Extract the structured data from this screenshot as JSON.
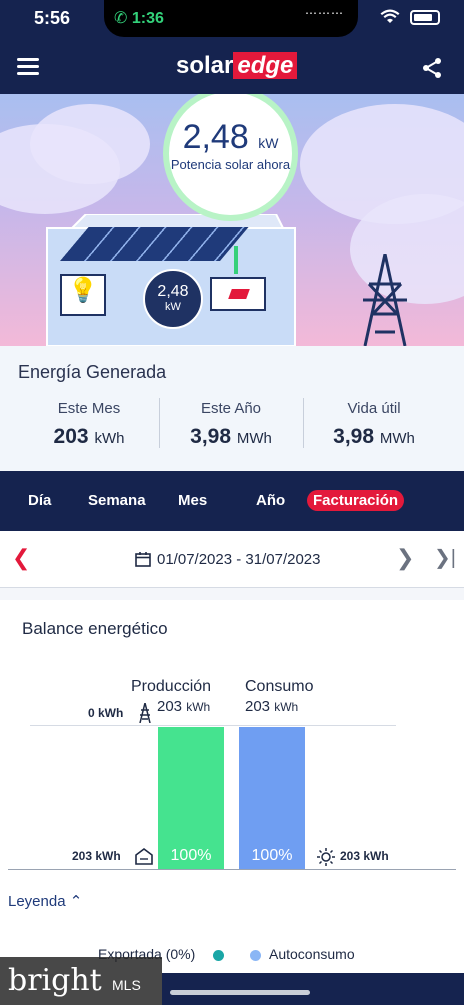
{
  "status_bar": {
    "time": "5:56",
    "call_time": "1:36"
  },
  "header": {
    "brand_solar": "solar",
    "brand_edge": "edge"
  },
  "hero": {
    "power_value": "2,48",
    "power_unit": "kW",
    "power_label": "Potencia solar ahora",
    "inverter_value": "2,48",
    "inverter_unit": "kW"
  },
  "energy": {
    "title": "Energía Generada",
    "stats": [
      {
        "label": "Este Mes",
        "value": "203",
        "unit": "kWh"
      },
      {
        "label": "Este Año",
        "value": "3,98",
        "unit": "MWh"
      },
      {
        "label": "Vida útil",
        "value": "3,98",
        "unit": "MWh"
      }
    ]
  },
  "tabs": [
    {
      "label": "Día"
    },
    {
      "label": "Semana"
    },
    {
      "label": "Mes"
    },
    {
      "label": "Año"
    },
    {
      "label": "Facturación",
      "active": true
    }
  ],
  "date_range": "01/07/2023 - 31/07/2023",
  "balance": {
    "title": "Balance energético",
    "production_label": "Producción",
    "production_value": "203",
    "production_unit": "kWh",
    "consumption_label": "Consumo",
    "consumption_value": "203",
    "consumption_unit": "kWh",
    "grid_export": "0 kWh",
    "self_left": "203 kWh",
    "self_right": "203 kWh",
    "production_pct": "100%",
    "consumption_pct": "100%",
    "colors": {
      "production": "#45e38f",
      "consumption": "#6f9ef2"
    }
  },
  "legend": {
    "title": "Leyenda",
    "items": [
      {
        "label": "Exportada (0%)",
        "color": "#1aa6a6"
      },
      {
        "label": "Autoconsumo",
        "color": "#8ab6f5"
      }
    ]
  },
  "watermark": {
    "brand": "bright",
    "suffix": "MLS"
  }
}
